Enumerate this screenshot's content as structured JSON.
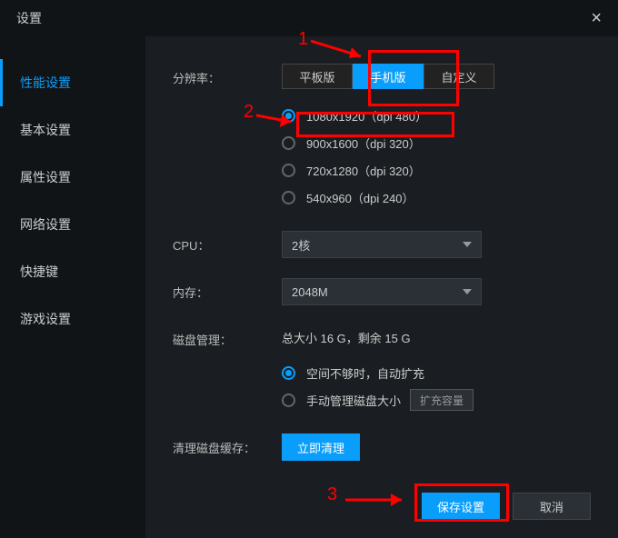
{
  "header": {
    "title": "设置"
  },
  "sidebar": {
    "items": [
      {
        "label": "性能设置"
      },
      {
        "label": "基本设置"
      },
      {
        "label": "属性设置"
      },
      {
        "label": "网络设置"
      },
      {
        "label": "快捷键"
      },
      {
        "label": "游戏设置"
      }
    ]
  },
  "resolution": {
    "label": "分辨率：",
    "tabs": {
      "tablet": "平板版",
      "phone": "手机版",
      "custom": "自定义"
    },
    "options": [
      "1080x1920（dpi 480）",
      "900x1600（dpi 320）",
      "720x1280（dpi 320）",
      "540x960（dpi 240）"
    ]
  },
  "cpu": {
    "label": "CPU：",
    "value": "2核"
  },
  "memory": {
    "label": "内存：",
    "value": "2048M"
  },
  "disk": {
    "label": "磁盘管理：",
    "info": "总大小 16 G，剩余 15 G",
    "auto": "空间不够时，自动扩充",
    "manual": "手动管理磁盘大小",
    "expand": "扩充容量"
  },
  "clear": {
    "label": "清理磁盘缓存：",
    "button": "立即清理"
  },
  "footer": {
    "save": "保存设置",
    "cancel": "取消"
  },
  "annotations": {
    "n1": "1",
    "n2": "2",
    "n3": "3"
  }
}
